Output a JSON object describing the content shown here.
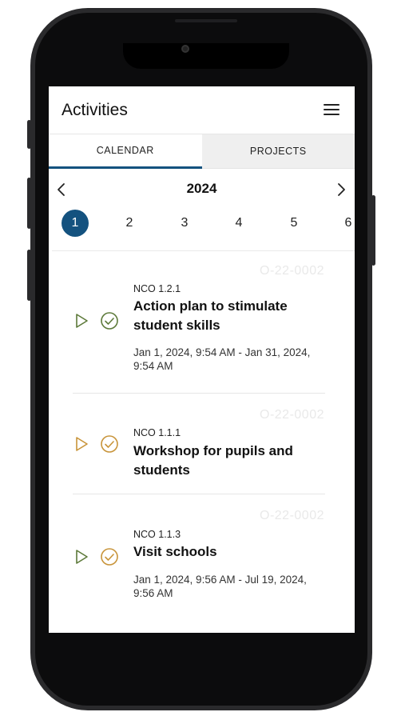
{
  "header": {
    "title": "Activities",
    "menu_icon": "hamburger-menu-icon"
  },
  "tabs": [
    {
      "label": "CALENDAR",
      "active": true
    },
    {
      "label": "PROJECTS",
      "active": false
    }
  ],
  "calendar": {
    "year": "2024",
    "prev_icon": "chevron-left-icon",
    "next_icon": "chevron-right-icon",
    "months": [
      "1",
      "2",
      "3",
      "4",
      "5",
      "6"
    ],
    "selected_month": "1"
  },
  "activities": [
    {
      "id": "O-22-0002",
      "code": "NCO 1.2.1",
      "title": "Action plan to stimulate student skills",
      "dates": "Jan 1, 2024, 9:54 AM - Jan 31, 2024, 9:54 AM",
      "icon_color": "#5d7a3a"
    },
    {
      "id": "O-22-0002",
      "code": "NCO 1.1.1",
      "title": "Workshop for pupils and students",
      "dates": "",
      "icon_color": "#c8943a"
    },
    {
      "id": "O-22-0002",
      "code": "NCO 1.1.3",
      "title": "Visit schools",
      "dates": "Jan 1, 2024, 9:56 AM - Jul 19, 2024, 9:56 AM",
      "play_color": "#5d7a3a",
      "check_color": "#c8943a"
    }
  ],
  "colors": {
    "accent": "#14527f",
    "tab_inactive_bg": "#efefef"
  }
}
